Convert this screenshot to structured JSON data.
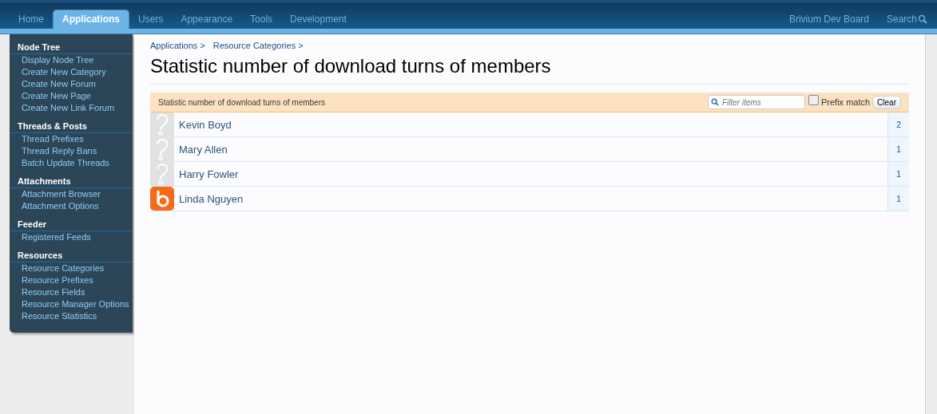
{
  "tabs": [
    {
      "label": "Home",
      "selected": false
    },
    {
      "label": "Applications",
      "selected": true
    },
    {
      "label": "Users",
      "selected": false
    },
    {
      "label": "Appearance",
      "selected": false
    },
    {
      "label": "Tools",
      "selected": false
    },
    {
      "label": "Development",
      "selected": false
    }
  ],
  "header_links": {
    "board": "Brivium Dev Board",
    "search": "Search"
  },
  "sidebar": {
    "sections": [
      {
        "title": "Node Tree",
        "items": [
          "Display Node Tree",
          "Create New Category",
          "Create New Forum",
          "Create New Page",
          "Create New Link Forum"
        ]
      },
      {
        "title": "Threads & Posts",
        "items": [
          "Thread Prefixes",
          "Thread Reply Bans",
          "Batch Update Threads"
        ]
      },
      {
        "title": "Attachments",
        "items": [
          "Attachment Browser",
          "Attachment Options"
        ]
      },
      {
        "title": "Feeder",
        "items": [
          "Registered Feeds"
        ]
      },
      {
        "title": "Resources",
        "items": [
          "Resource Categories",
          "Resource Prefixes",
          "Resource Fields",
          "Resource Manager Options",
          "Resource Statistics"
        ]
      }
    ]
  },
  "breadcrumbs": [
    "Applications >",
    "Resource Categories >"
  ],
  "page_title": "Statistic number of download turns of members",
  "list": {
    "heading": "Statistic number of download turns of members",
    "filter": {
      "placeholder": "Filter items"
    },
    "prefix_match": {
      "label": "Prefix match",
      "checked": false
    },
    "clear_button": "Clear",
    "rows": [
      {
        "name": "Kevin Boyd",
        "count": "2",
        "kind": "default"
      },
      {
        "name": "Mary Allen",
        "count": "1",
        "kind": "default"
      },
      {
        "name": "Harry Fowler",
        "count": "1",
        "kind": "default"
      },
      {
        "name": "Linda Nguyen",
        "count": "1",
        "kind": "logo"
      }
    ]
  }
}
